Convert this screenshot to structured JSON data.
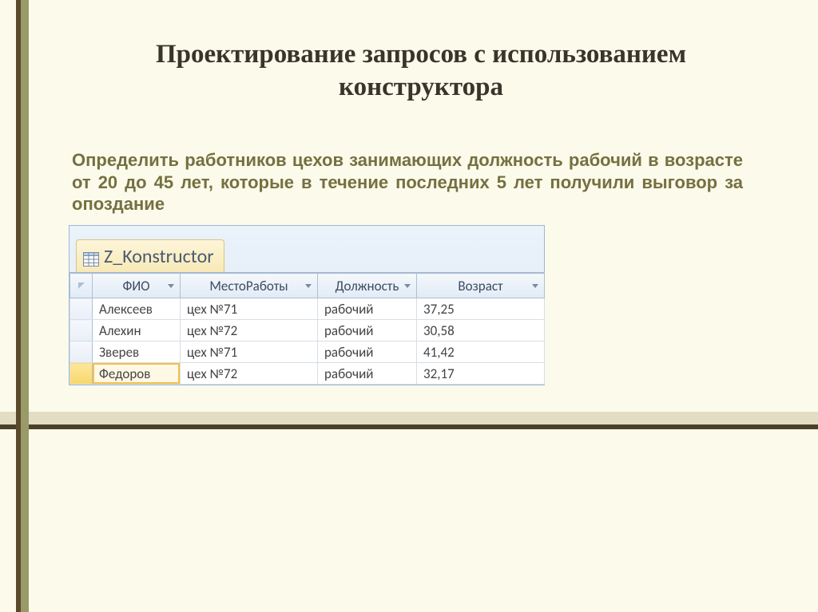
{
  "slide": {
    "title": "Проектирование запросов с использованием конструктора",
    "task": "Определить работников цехов занимающих должность рабочий в возрасте от 20 до 45 лет, которые в течение последних 5 лет получили выговор за опоздание"
  },
  "query_tab": {
    "label": "Z_Konstructor"
  },
  "grid": {
    "headers": {
      "fio": "ФИО",
      "work": "МестоРаботы",
      "pos": "Должность",
      "age": "Возраст"
    },
    "rows": [
      {
        "fio": "Алексеев",
        "work": "цех №71",
        "pos": "рабочий",
        "age": "37,25"
      },
      {
        "fio": "Алехин",
        "work": "цех №72",
        "pos": "рабочий",
        "age": "30,58"
      },
      {
        "fio": "Зверев",
        "work": "цех №71",
        "pos": "рабочий",
        "age": "41,42"
      },
      {
        "fio": "Федоров",
        "work": "цех №72",
        "pos": "рабочий",
        "age": "32,17"
      }
    ]
  }
}
